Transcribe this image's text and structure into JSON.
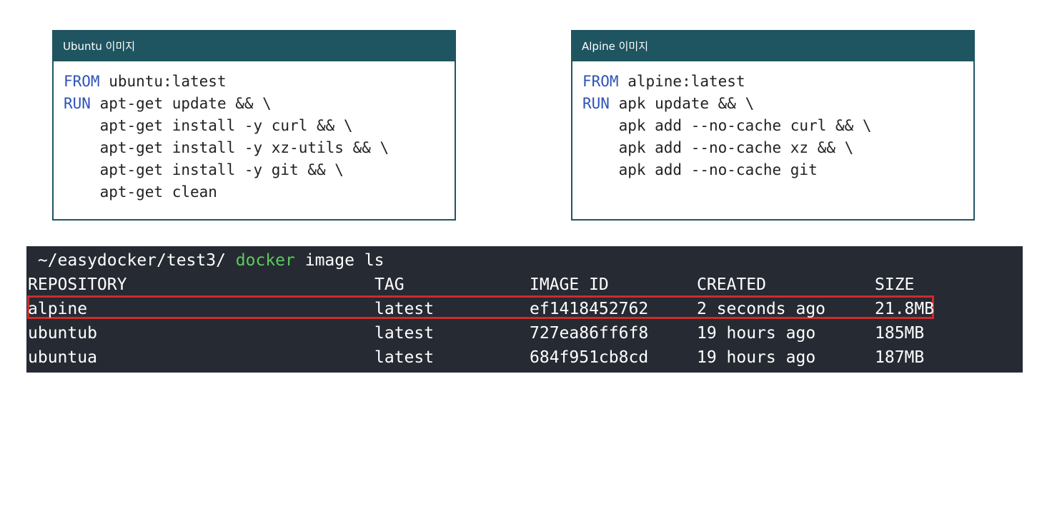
{
  "ubuntu_card": {
    "title": "Ubuntu 이미지",
    "lines": [
      {
        "kw": "FROM",
        "rest": " ubuntu:latest"
      },
      {
        "kw": "RUN",
        "rest": " apt-get update && \\"
      },
      {
        "kw": "",
        "rest": "    apt-get install -y curl && \\"
      },
      {
        "kw": "",
        "rest": "    apt-get install -y xz-utils && \\"
      },
      {
        "kw": "",
        "rest": "    apt-get install -y git && \\"
      },
      {
        "kw": "",
        "rest": "    apt-get clean"
      }
    ]
  },
  "alpine_card": {
    "title": "Alpine 이미지",
    "lines": [
      {
        "kw": "FROM",
        "rest": " alpine:latest"
      },
      {
        "kw": "RUN",
        "rest": " apk update && \\"
      },
      {
        "kw": "",
        "rest": "    apk add --no-cache curl && \\"
      },
      {
        "kw": "",
        "rest": "    apk add --no-cache xz && \\"
      },
      {
        "kw": "",
        "rest": "    apk add --no-cache git"
      }
    ]
  },
  "terminal": {
    "prompt_icon": "",
    "prompt_path": " ~/easydocker/test3/ ",
    "command": "docker",
    "args": " image ls",
    "headers": [
      "REPOSITORY",
      "TAG",
      "IMAGE ID",
      "CREATED",
      "SIZE"
    ],
    "rows": [
      [
        "alpine",
        "latest",
        "ef1418452762",
        "2 seconds ago",
        "21.8MB"
      ],
      [
        "ubuntub",
        "latest",
        "727ea86ff6f8",
        "19 hours ago",
        "185MB"
      ],
      [
        "ubuntua",
        "latest",
        "684f951cb8cd",
        "19 hours ago",
        "187MB"
      ]
    ],
    "highlighted_row": 0,
    "colors": {
      "background": "#262a33",
      "command": "#5ccb5c",
      "highlight": "#d02a2a"
    }
  }
}
